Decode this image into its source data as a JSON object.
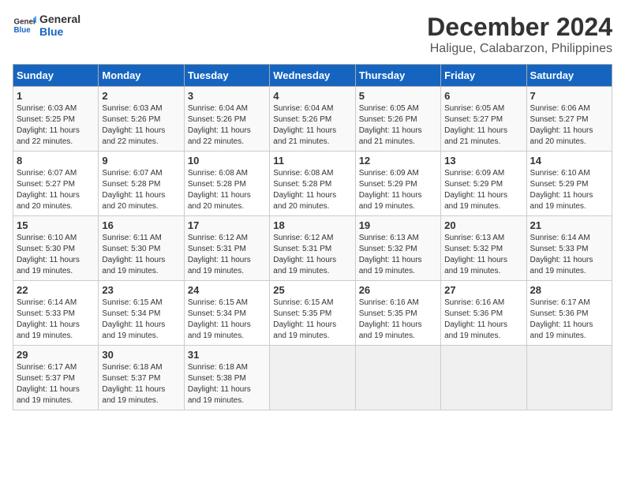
{
  "logo": {
    "line1": "General",
    "line2": "Blue"
  },
  "title": "December 2024",
  "subtitle": "Haligue, Calabarzon, Philippines",
  "days_of_week": [
    "Sunday",
    "Monday",
    "Tuesday",
    "Wednesday",
    "Thursday",
    "Friday",
    "Saturday"
  ],
  "weeks": [
    [
      {
        "day": "1",
        "info": "Sunrise: 6:03 AM\nSunset: 5:25 PM\nDaylight: 11 hours\nand 22 minutes."
      },
      {
        "day": "2",
        "info": "Sunrise: 6:03 AM\nSunset: 5:26 PM\nDaylight: 11 hours\nand 22 minutes."
      },
      {
        "day": "3",
        "info": "Sunrise: 6:04 AM\nSunset: 5:26 PM\nDaylight: 11 hours\nand 22 minutes."
      },
      {
        "day": "4",
        "info": "Sunrise: 6:04 AM\nSunset: 5:26 PM\nDaylight: 11 hours\nand 21 minutes."
      },
      {
        "day": "5",
        "info": "Sunrise: 6:05 AM\nSunset: 5:26 PM\nDaylight: 11 hours\nand 21 minutes."
      },
      {
        "day": "6",
        "info": "Sunrise: 6:05 AM\nSunset: 5:27 PM\nDaylight: 11 hours\nand 21 minutes."
      },
      {
        "day": "7",
        "info": "Sunrise: 6:06 AM\nSunset: 5:27 PM\nDaylight: 11 hours\nand 20 minutes."
      }
    ],
    [
      {
        "day": "8",
        "info": "Sunrise: 6:07 AM\nSunset: 5:27 PM\nDaylight: 11 hours\nand 20 minutes."
      },
      {
        "day": "9",
        "info": "Sunrise: 6:07 AM\nSunset: 5:28 PM\nDaylight: 11 hours\nand 20 minutes."
      },
      {
        "day": "10",
        "info": "Sunrise: 6:08 AM\nSunset: 5:28 PM\nDaylight: 11 hours\nand 20 minutes."
      },
      {
        "day": "11",
        "info": "Sunrise: 6:08 AM\nSunset: 5:28 PM\nDaylight: 11 hours\nand 20 minutes."
      },
      {
        "day": "12",
        "info": "Sunrise: 6:09 AM\nSunset: 5:29 PM\nDaylight: 11 hours\nand 19 minutes."
      },
      {
        "day": "13",
        "info": "Sunrise: 6:09 AM\nSunset: 5:29 PM\nDaylight: 11 hours\nand 19 minutes."
      },
      {
        "day": "14",
        "info": "Sunrise: 6:10 AM\nSunset: 5:29 PM\nDaylight: 11 hours\nand 19 minutes."
      }
    ],
    [
      {
        "day": "15",
        "info": "Sunrise: 6:10 AM\nSunset: 5:30 PM\nDaylight: 11 hours\nand 19 minutes."
      },
      {
        "day": "16",
        "info": "Sunrise: 6:11 AM\nSunset: 5:30 PM\nDaylight: 11 hours\nand 19 minutes."
      },
      {
        "day": "17",
        "info": "Sunrise: 6:12 AM\nSunset: 5:31 PM\nDaylight: 11 hours\nand 19 minutes."
      },
      {
        "day": "18",
        "info": "Sunrise: 6:12 AM\nSunset: 5:31 PM\nDaylight: 11 hours\nand 19 minutes."
      },
      {
        "day": "19",
        "info": "Sunrise: 6:13 AM\nSunset: 5:32 PM\nDaylight: 11 hours\nand 19 minutes."
      },
      {
        "day": "20",
        "info": "Sunrise: 6:13 AM\nSunset: 5:32 PM\nDaylight: 11 hours\nand 19 minutes."
      },
      {
        "day": "21",
        "info": "Sunrise: 6:14 AM\nSunset: 5:33 PM\nDaylight: 11 hours\nand 19 minutes."
      }
    ],
    [
      {
        "day": "22",
        "info": "Sunrise: 6:14 AM\nSunset: 5:33 PM\nDaylight: 11 hours\nand 19 minutes."
      },
      {
        "day": "23",
        "info": "Sunrise: 6:15 AM\nSunset: 5:34 PM\nDaylight: 11 hours\nand 19 minutes."
      },
      {
        "day": "24",
        "info": "Sunrise: 6:15 AM\nSunset: 5:34 PM\nDaylight: 11 hours\nand 19 minutes."
      },
      {
        "day": "25",
        "info": "Sunrise: 6:15 AM\nSunset: 5:35 PM\nDaylight: 11 hours\nand 19 minutes."
      },
      {
        "day": "26",
        "info": "Sunrise: 6:16 AM\nSunset: 5:35 PM\nDaylight: 11 hours\nand 19 minutes."
      },
      {
        "day": "27",
        "info": "Sunrise: 6:16 AM\nSunset: 5:36 PM\nDaylight: 11 hours\nand 19 minutes."
      },
      {
        "day": "28",
        "info": "Sunrise: 6:17 AM\nSunset: 5:36 PM\nDaylight: 11 hours\nand 19 minutes."
      }
    ],
    [
      {
        "day": "29",
        "info": "Sunrise: 6:17 AM\nSunset: 5:37 PM\nDaylight: 11 hours\nand 19 minutes."
      },
      {
        "day": "30",
        "info": "Sunrise: 6:18 AM\nSunset: 5:37 PM\nDaylight: 11 hours\nand 19 minutes."
      },
      {
        "day": "31",
        "info": "Sunrise: 6:18 AM\nSunset: 5:38 PM\nDaylight: 11 hours\nand 19 minutes."
      },
      {
        "day": "",
        "info": ""
      },
      {
        "day": "",
        "info": ""
      },
      {
        "day": "",
        "info": ""
      },
      {
        "day": "",
        "info": ""
      }
    ]
  ]
}
